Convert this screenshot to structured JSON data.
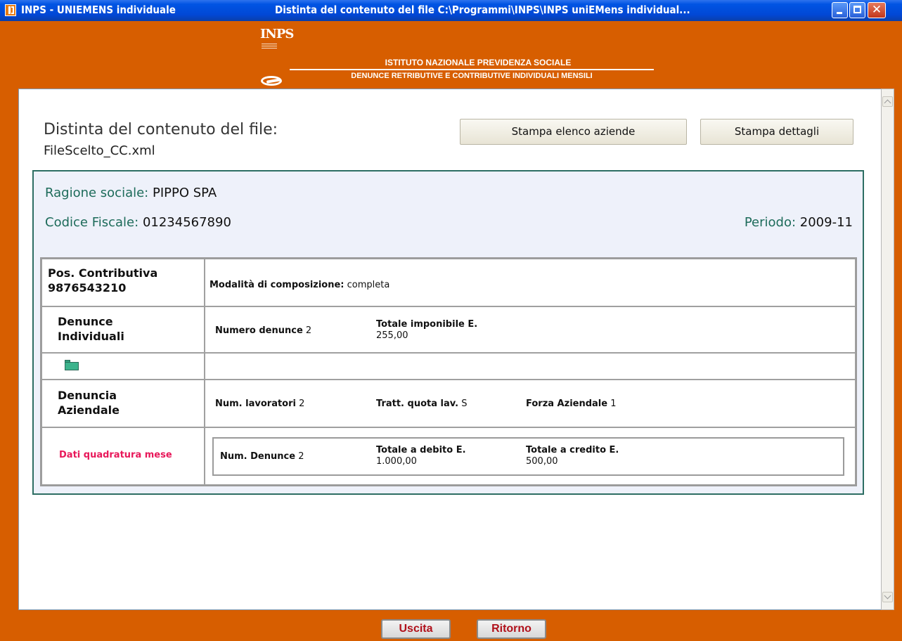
{
  "window": {
    "title_left": "INPS  - UNIEMENS individuale",
    "title_right": "Distinta del contenuto del file  C:\\Programmi\\INPS\\INPS uniEMens individual...",
    "app_icon": "inps-app-icon",
    "controls": {
      "minimize": "minimize-icon",
      "maximize": "maximize-icon",
      "close": "close-icon",
      "close_glyph": "✕"
    }
  },
  "header": {
    "logo_text": "INPS",
    "institute": "ISTITUTO NAZIONALE PREVIDENZA SOCIALE",
    "subtitle": "DENUNCE RETRIBUTIVE E CONTRIBUTIVE INDIVIDUALI MENSILI"
  },
  "page": {
    "title": "Distinta del contenuto del file:",
    "filename": "FileScelto_CC.xml",
    "buttons": {
      "print_companies": "Stampa elenco aziende",
      "print_details": "Stampa dettagli"
    }
  },
  "company": {
    "ragione_label": "Ragione sociale:",
    "ragione_value": "PIPPO SPA",
    "cf_label": "Codice Fiscale:",
    "cf_value": "01234567890",
    "periodo_label": "Periodo:",
    "periodo_value": "2009-11"
  },
  "grid": {
    "pos_label": "Pos. Contributiva",
    "pos_value": "9876543210",
    "modalita_label": "Modalità di composizione:",
    "modalita_value": "completa",
    "denunce_ind_label_1": "Denunce",
    "denunce_ind_label_2": "Individuali",
    "numero_denunce_label": "Numero denunce",
    "numero_denunce_value": "2",
    "totale_imponibile_label": "Totale imponibile E.",
    "totale_imponibile_value": "255,00",
    "folder_icon": "folder-icon",
    "denuncia_az_label_1": "Denuncia",
    "denuncia_az_label_2": "Aziendale",
    "num_lavoratori_label": "Num. lavoratori",
    "num_lavoratori_value": "2",
    "tratt_quota_label": "Tratt. quota lav.",
    "tratt_quota_value": "S",
    "forza_label": "Forza Aziendale",
    "forza_value": "1",
    "quadratura_label": "Dati quadratura mese",
    "num_denunce_label": "Num. Denunce",
    "num_denunce_value": "2",
    "totale_debito_label": "Totale a debito E.",
    "totale_debito_value": "1.000,00",
    "totale_credito_label": "Totale a credito E.",
    "totale_credito_value": "500,00"
  },
  "footer": {
    "exit": "Uscita",
    "back": "Ritorno"
  }
}
